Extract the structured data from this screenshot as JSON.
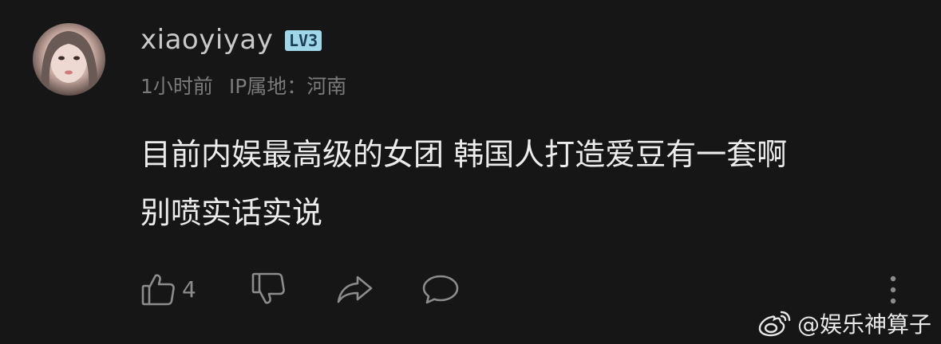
{
  "comment": {
    "username": "xiaoyiyay",
    "level_badge": "LV3",
    "time": "1小时前",
    "ip_label": "IP属地：河南",
    "lines": [
      "目前内娱最高级的女团 韩国人打造爱豆有一套啊",
      "别喷实话实说"
    ],
    "likes": "4"
  },
  "icons": {
    "like": "thumbs-up-icon",
    "dislike": "thumbs-down-icon",
    "share": "share-arrow-icon",
    "reply": "comment-bubble-icon",
    "more": "more-vertical-icon",
    "watermark_logo": "weibo-icon"
  },
  "watermark": {
    "text": "@娱乐神算子"
  },
  "colors": {
    "background": "#161616",
    "text_primary": "#ececec",
    "text_secondary": "#7b7b7b",
    "badge": "#9fd7e8"
  }
}
